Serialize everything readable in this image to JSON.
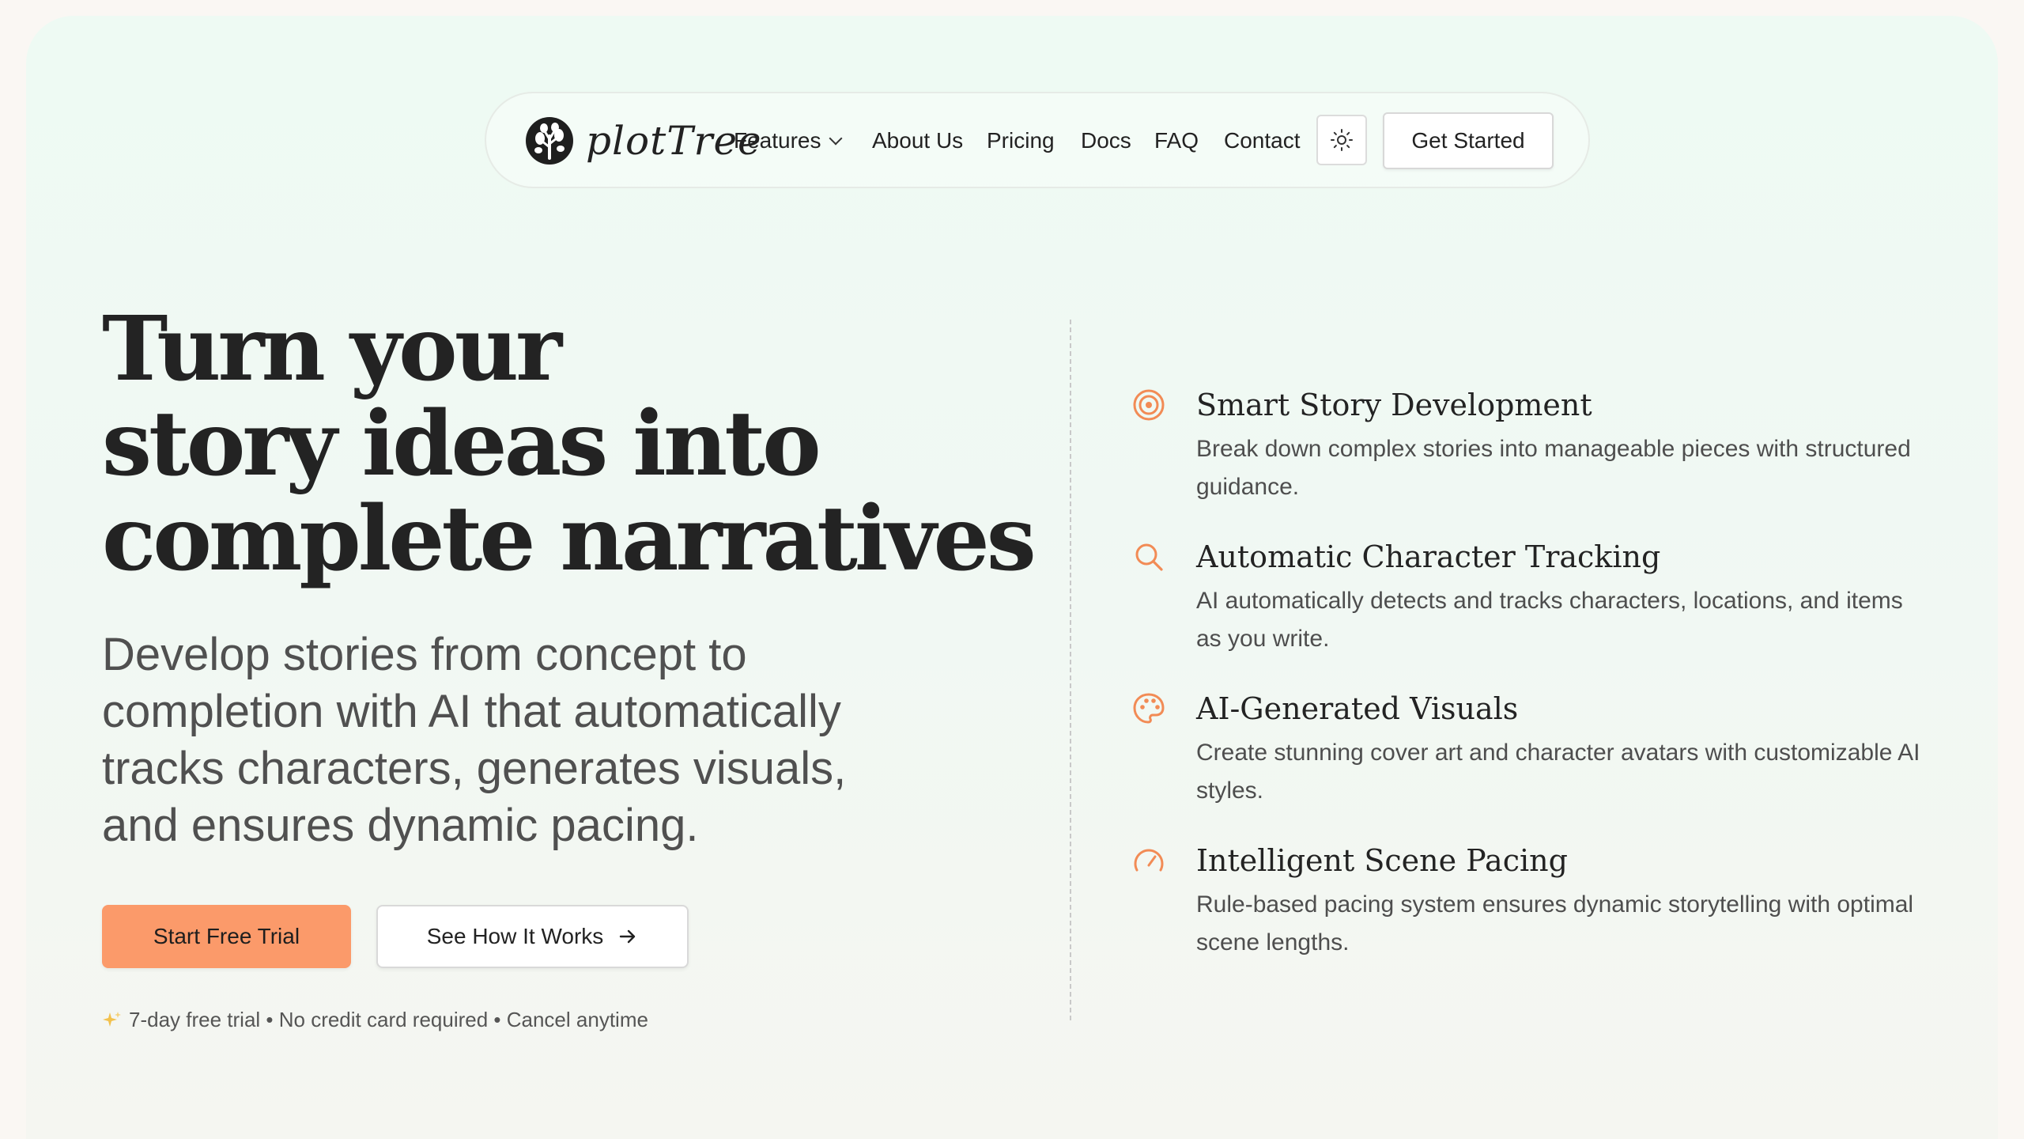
{
  "brand": {
    "name": "plotTree",
    "logo_icon": "tree-logo-icon"
  },
  "nav": {
    "items": [
      {
        "label": "Features",
        "has_dropdown": true
      },
      {
        "label": "About Us"
      },
      {
        "label": "Pricing"
      },
      {
        "label": "Docs"
      },
      {
        "label": "FAQ"
      },
      {
        "label": "Contact"
      }
    ],
    "theme_toggle_icon": "sun-icon",
    "cta_label": "Get Started"
  },
  "hero": {
    "headline_lines": [
      "Turn your",
      "story ideas into",
      "complete narratives"
    ],
    "subhead_lines": [
      "Develop stories from concept to",
      "completion with AI that automatically",
      "tracks characters, generates visuals,",
      "and ensures dynamic pacing."
    ],
    "primary_button": "Start Free Trial",
    "secondary_button": "See How It Works",
    "secondary_button_icon": "arrow-right-icon",
    "fineprint": "7-day free trial • No credit card required • Cancel anytime",
    "fineprint_icon": "sparkle-icon"
  },
  "features": [
    {
      "icon": "target-icon",
      "title": "Smart Story Development",
      "desc_lines": [
        "Break down complex stories into manageable pieces with structured",
        "guidance."
      ]
    },
    {
      "icon": "search-icon",
      "title": "Automatic Character Tracking",
      "desc_lines": [
        "AI automatically detects and tracks characters, locations, and items",
        "as you write."
      ]
    },
    {
      "icon": "palette-icon",
      "title": "AI-Generated Visuals",
      "desc_lines": [
        "Create stunning cover art and character avatars with customizable AI",
        "styles."
      ]
    },
    {
      "icon": "gauge-icon",
      "title": "Intelligent Scene Pacing",
      "desc_lines": [
        "Rule-based pacing system ensures dynamic storytelling with optimal",
        "scene lengths."
      ]
    }
  ],
  "colors": {
    "accent": "#fb9a6a",
    "icon_accent": "#f28b55",
    "background": "#eefaf3",
    "text": "#232323"
  }
}
